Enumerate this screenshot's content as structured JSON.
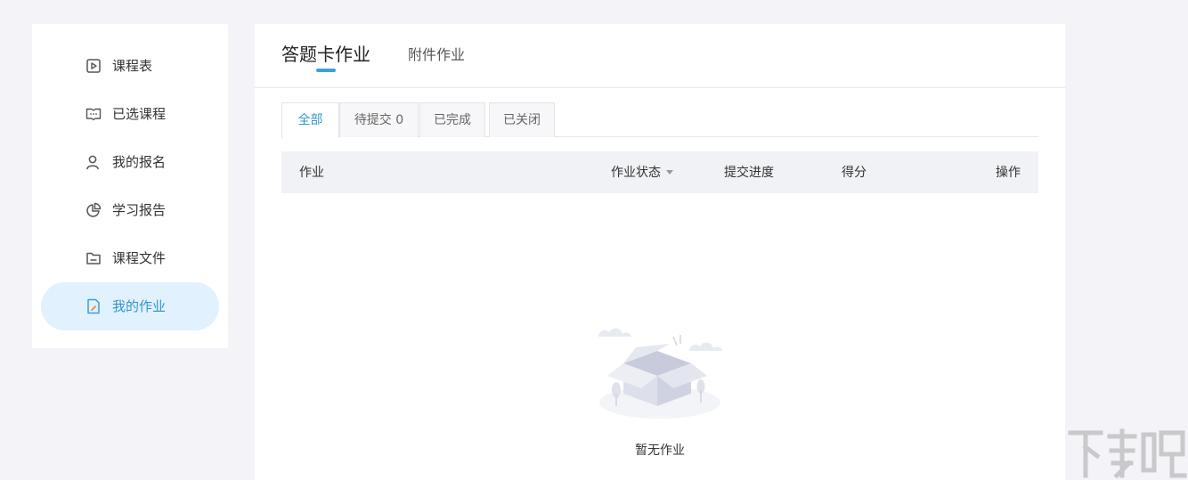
{
  "sidebar": {
    "items": [
      {
        "label": "课程表",
        "icon": "play-square-icon"
      },
      {
        "label": "已选课程",
        "icon": "book-open-icon"
      },
      {
        "label": "我的报名",
        "icon": "user-icon"
      },
      {
        "label": "学习报告",
        "icon": "pie-chart-icon"
      },
      {
        "label": "课程文件",
        "icon": "folder-icon"
      },
      {
        "label": "我的作业",
        "icon": "edit-document-icon",
        "active": true
      }
    ]
  },
  "main": {
    "top_tabs": [
      "答题卡作业",
      "附件作业"
    ],
    "sub_tabs": [
      "全部",
      "待提交 0",
      "已完成",
      "已关闭"
    ],
    "table": {
      "columns": [
        "作业",
        "作业状态",
        "提交进度",
        "得分",
        "操作"
      ]
    },
    "empty_text": "暂无作业"
  },
  "watermark": "下载吧",
  "colors": {
    "accent": "#3396c9",
    "active_bg": "#e1f1fd",
    "page_bg": "#f4f4f8",
    "header_bg": "#f1f2f6"
  }
}
